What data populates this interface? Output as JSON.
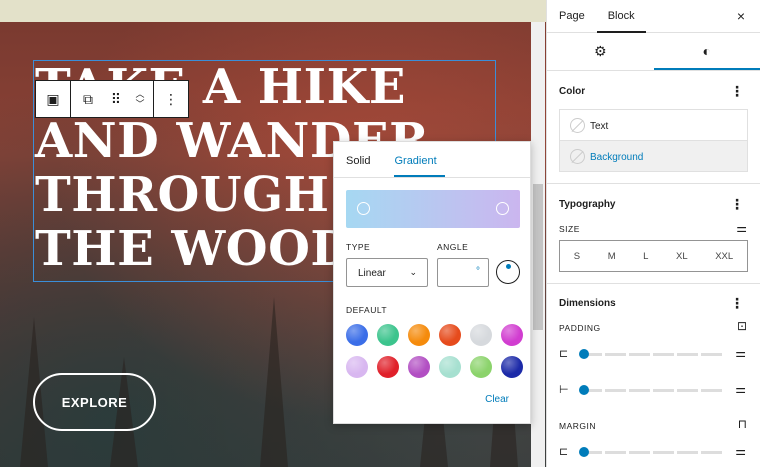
{
  "heading": "TAKE A HIKE\nAND WANDER\nTHROUGH\nTHE WOODS",
  "explore_label": "EXPLORE",
  "popover": {
    "tabs": [
      "Solid",
      "Gradient"
    ],
    "type_label": "TYPE",
    "type_value": "Linear",
    "angle_label": "ANGLE",
    "angle_unit": "°",
    "default_label": "DEFAULT",
    "clear_label": "Clear",
    "gradient_colors": [
      "#a6d8f2",
      "#cbb6ef"
    ],
    "swatches": [
      "#3b6ee8",
      "#3cc48d",
      "#f58b0c",
      "#e64b1c",
      "#d6d9dd",
      "#d13dd0",
      "#d8b7f0",
      "#e0202a",
      "#b24fc3",
      "#a6e0d0",
      "#8bd36b",
      "#1c2aa8"
    ]
  },
  "sidebar": {
    "tabs": [
      "Page",
      "Block"
    ],
    "close_icon": "×",
    "color": {
      "title": "Color",
      "items": [
        "Text",
        "Background"
      ]
    },
    "typography": {
      "title": "Typography",
      "size_label": "SIZE",
      "sizes": [
        "S",
        "M",
        "L",
        "XL",
        "XXL"
      ]
    },
    "dimensions": {
      "title": "Dimensions",
      "padding_label": "PADDING",
      "margin_label": "MARGIN"
    }
  }
}
